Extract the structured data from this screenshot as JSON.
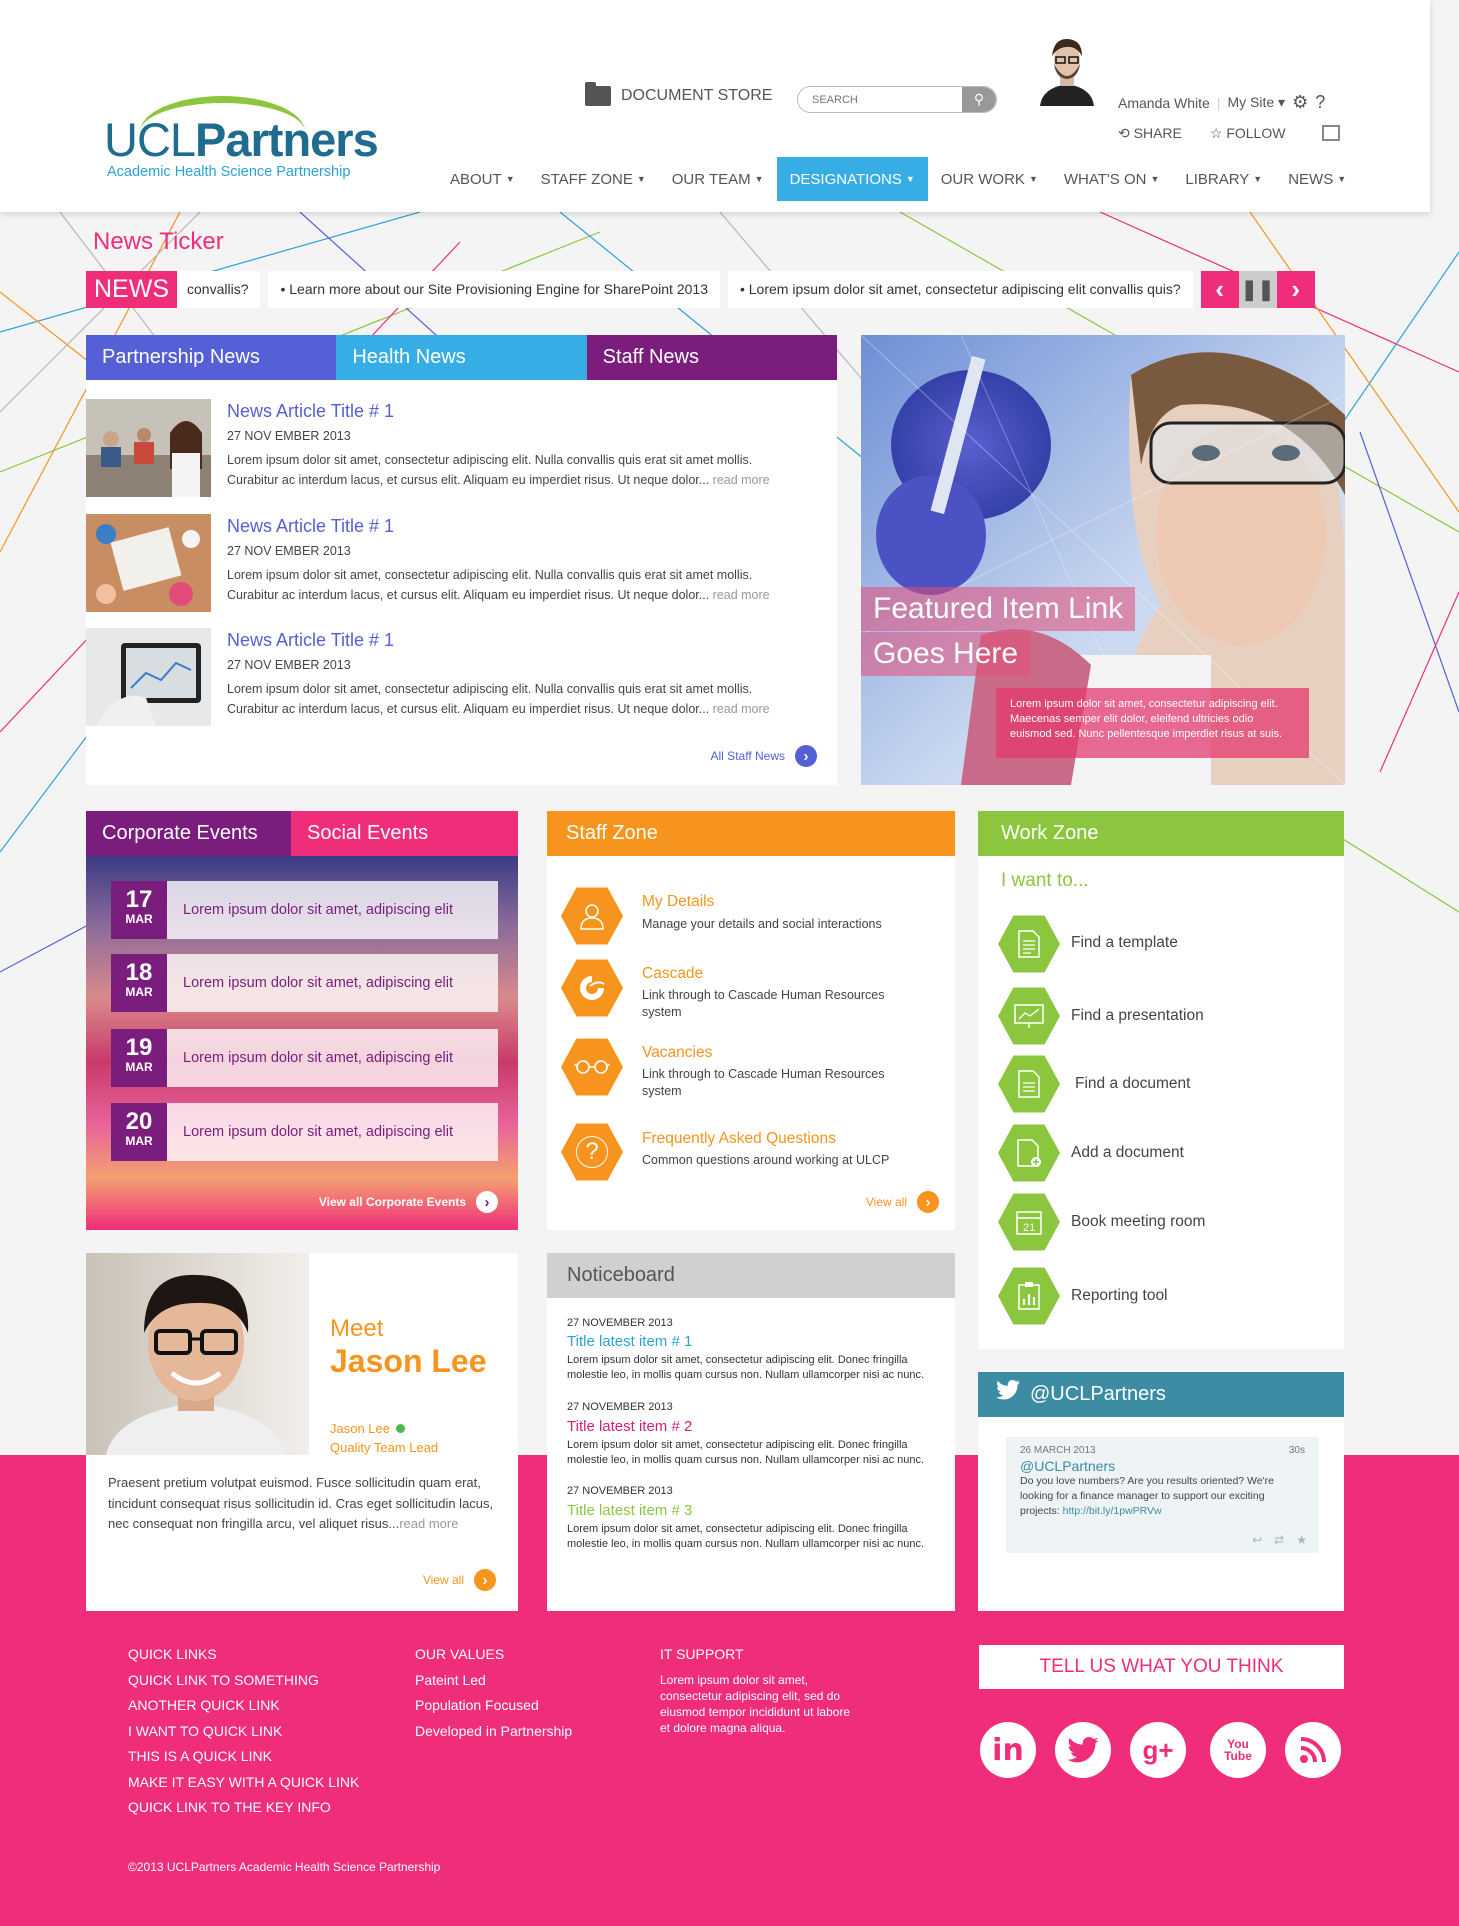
{
  "brand": {
    "logo_part1": "UCL",
    "logo_part2": "Partners",
    "tagline": "Academic Health Science Partnership"
  },
  "header": {
    "document_store": "DOCUMENT STORE",
    "search_placeholder": "SEARCH",
    "user_name": "Amanda White",
    "my_site": "My Site ▾",
    "share": "SHARE",
    "follow": "FOLLOW"
  },
  "nav": [
    {
      "label": "ABOUT"
    },
    {
      "label": "STAFF ZONE"
    },
    {
      "label": "OUR TEAM"
    },
    {
      "label": "DESIGNATIONS"
    },
    {
      "label": "OUR WORK"
    },
    {
      "label": "WHAT'S ON"
    },
    {
      "label": "LIBRARY"
    },
    {
      "label": "NEWS"
    }
  ],
  "ticker": {
    "title": "News Ticker",
    "label": "NEWS",
    "items": [
      "convallis?",
      "• Learn more about our Site Provisioning Engine for SharePoint 2013",
      "• Lorem ipsum dolor sit amet, consectetur adipiscing elit convallis quis?"
    ]
  },
  "news": {
    "tabs": [
      "Partnership News",
      "Health News",
      "Staff News"
    ],
    "articles": [
      {
        "title": "News Article Title # 1",
        "date": "27 NOV EMBER 2013",
        "text": "Lorem ipsum dolor sit amet, consectetur adipiscing elit. Nulla convallis quis erat sit amet mollis. Curabitur ac interdum lacus, et cursus elit. Aliquam eu imperdiet risus. Ut neque dolor...",
        "more": "read more"
      },
      {
        "title": "News Article Title # 1",
        "date": "27 NOV EMBER 2013",
        "text": "Lorem ipsum dolor sit amet, consectetur adipiscing elit. Nulla convallis quis erat sit amet mollis. Curabitur ac interdum lacus, et cursus elit. Aliquam eu imperdiet risus. Ut neque dolor...",
        "more": "read more"
      },
      {
        "title": "News Article Title # 1",
        "date": "27 NOV EMBER 2013",
        "text": "Lorem ipsum dolor sit amet, consectetur adipiscing elit. Nulla convallis quis erat sit amet mollis. Curabitur ac interdum lacus, et cursus elit. Aliquam eu imperdiet risus. Ut neque dolor...",
        "more": "read more"
      }
    ],
    "all_link": "All Staff News"
  },
  "featured": {
    "line1": "Featured Item Link",
    "line2": "Goes Here",
    "text": "Lorem ipsum dolor sit amet, consectetur adipiscing elit. Maecenas semper elit dolor, eleifend ultricies odio euismod sed. Nunc pellentesque imperdiet risus at suis."
  },
  "events": {
    "tabs": [
      "Corporate Events",
      "Social Events"
    ],
    "items": [
      {
        "day": "17",
        "month": "MAR",
        "text": "Lorem ipsum dolor sit amet, adipiscing elit"
      },
      {
        "day": "18",
        "month": "MAR",
        "text": "Lorem ipsum dolor sit amet, adipiscing elit"
      },
      {
        "day": "19",
        "month": "MAR",
        "text": "Lorem ipsum dolor sit amet, adipiscing elit"
      },
      {
        "day": "20",
        "month": "MAR",
        "text": "Lorem ipsum dolor sit amet, adipiscing elit"
      }
    ],
    "all_link": "View all Corporate Events"
  },
  "staff_zone": {
    "title": "Staff Zone",
    "items": [
      {
        "title": "My Details",
        "desc": "Manage your details and social interactions",
        "icon": "user-icon"
      },
      {
        "title": "Cascade",
        "desc": "Link through to Cascade Human Resources system",
        "icon": "cascade-icon"
      },
      {
        "title": "Vacancies",
        "desc": "Link through to Cascade Human Resources system",
        "icon": "glasses-icon"
      },
      {
        "title": "Frequently Asked Questions",
        "desc": "Common questions around working at ULCP",
        "icon": "question-icon"
      }
    ],
    "all_link": "View all"
  },
  "work_zone": {
    "title": "Work Zone",
    "subtitle": "I want to...",
    "items": [
      {
        "label": "Find a template",
        "icon": "template-icon"
      },
      {
        "label": "Find a presentation",
        "icon": "presentation-icon"
      },
      {
        "label": "Find a document",
        "icon": "document-icon"
      },
      {
        "label": "Add a document",
        "icon": "add-document-icon"
      },
      {
        "label": "Book meeting room",
        "icon": "calendar-icon",
        "icon_text": "21"
      },
      {
        "label": "Reporting tool",
        "icon": "report-icon"
      }
    ]
  },
  "meet": {
    "meet": "Meet",
    "name": "Jason Lee",
    "person": "Jason Lee",
    "role": "Quality Team Lead",
    "text": "Praesent pretium volutpat euismod. Fusce sollicitudin quam erat, tincidunt consequat risus sollicitudin id. Cras eget sollicitudin lacus, nec consequat non fringilla arcu, vel aliquet risus...",
    "more": "read more",
    "all_link": "View all"
  },
  "noticeboard": {
    "title": "Noticeboard",
    "items": [
      {
        "date": "27 NOVEMBER 2013",
        "title": "Title latest item # 1",
        "color": "#2ba3d6",
        "text": "Lorem ipsum dolor sit amet, consectetur adipiscing elit. Donec fringilla molestie leo, in mollis quam cursus non. Nullam ullamcorper nisi ac nunc."
      },
      {
        "date": "27 NOVEMBER 2013",
        "title": "Title latest item # 2",
        "color": "#d11e80",
        "text": "Lorem ipsum dolor sit amet, consectetur adipiscing elit. Donec fringilla molestie leo, in mollis quam cursus non. Nullam ullamcorper nisi ac nunc."
      },
      {
        "date": "27 NOVEMBER 2013",
        "title": "Title latest item # 3",
        "color": "#8cc63f",
        "text": "Lorem ipsum dolor sit amet, consectetur adipiscing elit. Donec fringilla molestie leo, in mollis quam cursus non. Nullam ullamcorper nisi ac nunc."
      }
    ]
  },
  "twitter": {
    "title": "@UCLPartners",
    "date": "26 MARCH 2013",
    "age": "30s",
    "handle": "@UCLPartners",
    "text": "Do you love numbers? Are you results oriented? We're looking for a finance manager to support our exciting projects:",
    "link": "http://bit.ly/1pwPRVw"
  },
  "footer": {
    "quick_links": [
      "QUICK LINKS",
      "QUICK LINK TO SOMETHING",
      "ANOTHER QUICK LINK",
      "I WANT TO QUICK LINK",
      "THIS IS A QUICK LINK",
      "MAKE IT EASY WITH A QUICK LINK",
      "QUICK LINK TO THE KEY INFO"
    ],
    "values_title": "OUR VALUES",
    "values": [
      "Pateint Led",
      "Population Focused",
      "Developed in Partnership"
    ],
    "it_title": "IT SUPPORT",
    "it_text": "Lorem ipsum dolor sit amet, consectetur adipiscing elit, sed do eiusmod tempor incididunt ut labore et dolore magna aliqua.",
    "feedback": "TELL US WHAT YOU THINK",
    "social": [
      {
        "label": "in",
        "icon": "linkedin-icon"
      },
      {
        "label": "twitter",
        "icon": "twitter-icon"
      },
      {
        "label": "g+",
        "icon": "googleplus-icon"
      },
      {
        "label": "You Tube",
        "icon": "youtube-icon"
      },
      {
        "label": "rss",
        "icon": "rss-icon"
      }
    ],
    "copyright": "©2013 UCLPartners Academic Health Science Partnership"
  },
  "colors": {
    "pink": "#ef2d7a",
    "purple": "#7a1d7d",
    "blue": "#5560d6",
    "cyan": "#36aee5",
    "orange": "#f7941d",
    "green": "#8cc63f",
    "teal": "#3c8ca3"
  }
}
